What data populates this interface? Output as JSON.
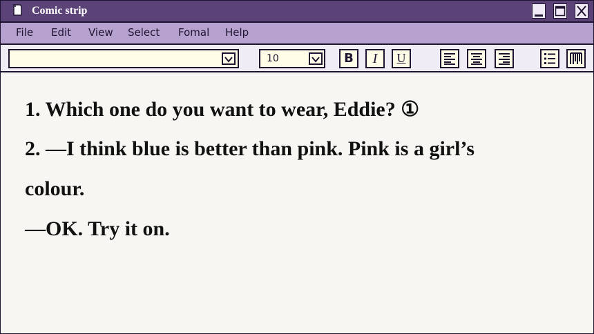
{
  "window": {
    "title": "Comic strip"
  },
  "menu": [
    "File",
    "Edit",
    "View",
    "Select",
    "Fomal",
    "Help"
  ],
  "toolbar": {
    "font_name": "",
    "font_size": "10",
    "bold_label": "B",
    "italic_label": "I",
    "underline_label": "U"
  },
  "content": {
    "lines": [
      "1. Which one do you want to wear, Eddie? ①",
      "2. —I think blue is better than pink. Pink is a girl’s",
      "colour.",
      "—OK. Try it on."
    ]
  },
  "colors": {
    "titlebar": "#5b4378",
    "menubar": "#b7a2cf",
    "toolbar": "#f0ecf5",
    "input_bg": "#fffde7",
    "content_bg": "#f7f6f3",
    "border": "#1e1430"
  },
  "icons": [
    "document-icon",
    "minimize-icon",
    "maximize-icon",
    "close-icon",
    "chevron-down-icon",
    "align-left-icon",
    "align-center-icon",
    "align-right-icon",
    "bullet-list-icon",
    "columns-icon"
  ]
}
